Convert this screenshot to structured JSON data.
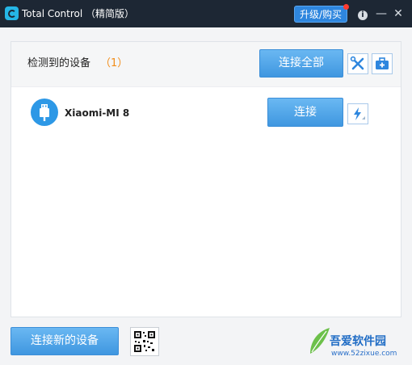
{
  "window": {
    "title": "Total Control （精简版）",
    "upgrade_label": "升级/购买",
    "info_glyph": "i",
    "minimize_glyph": "—",
    "close_glyph": "✕"
  },
  "devices_panel": {
    "header_label": "检测到的设备",
    "count_text": "（1）",
    "connect_all_label": "连接全部",
    "tools_icon": "wrench-screwdriver-icon",
    "toolkit_icon": "toolbox-icon"
  },
  "devices": [
    {
      "name": "Xiaomi-MI 8",
      "icon": "usb-icon",
      "connect_label": "连接",
      "action_icon": "flash-icon"
    }
  ],
  "footer": {
    "add_device_label": "连接新的设备",
    "qr_icon": "qr-code-icon"
  },
  "watermark": {
    "site_name": "吾爱软件园",
    "url": "www.52zixue.com"
  },
  "colors": {
    "titlebar": "#1d2734",
    "accent_blue": "#3f97e0",
    "count_orange": "#f28c18",
    "badge_red": "#ff3b2f"
  }
}
